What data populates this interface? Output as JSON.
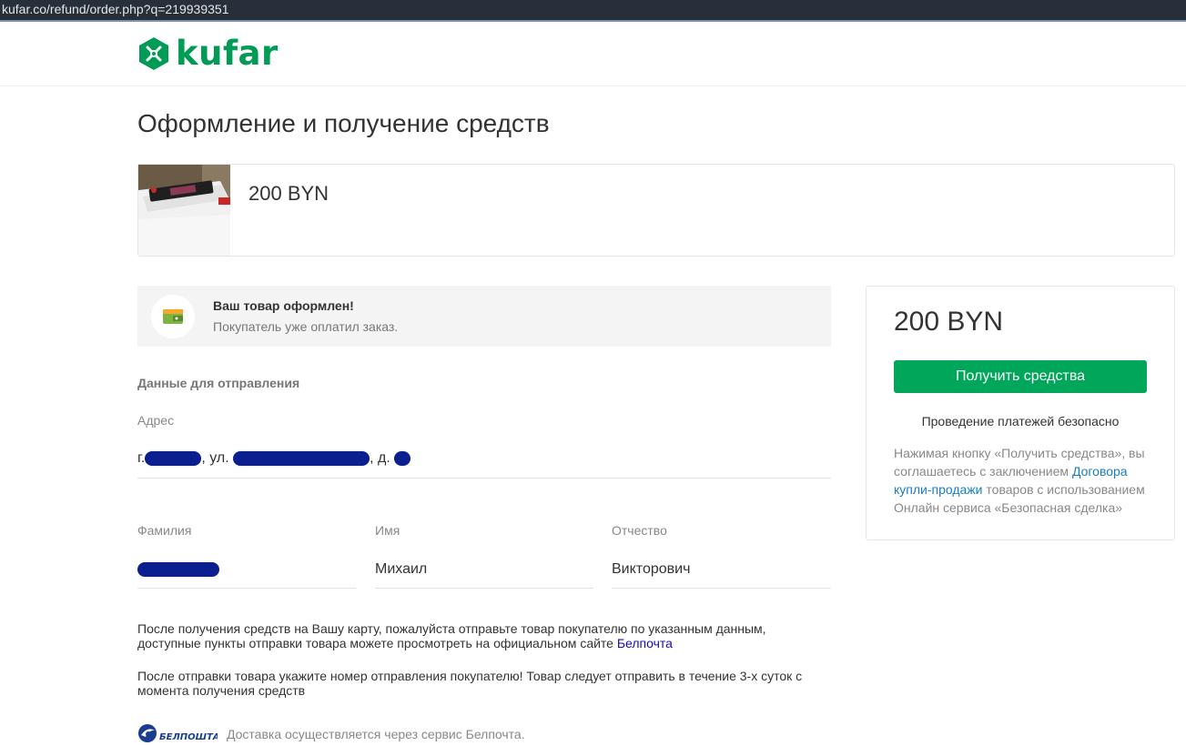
{
  "browser": {
    "url": "kufar.co/refund/order.php?q=219939351"
  },
  "brand": {
    "name": "kufar",
    "color": "#009c56"
  },
  "page": {
    "title": "Оформление и получение средств"
  },
  "product": {
    "price": "200 BYN"
  },
  "notice": {
    "title": "Ваш товар оформлен!",
    "subtitle": "Покупатель уже оплатил заказ."
  },
  "shipping": {
    "section_title": "Данные для отправления",
    "address_label": "Адрес",
    "address_city_prefix": "г.",
    "address_street_prefix": ", ул.",
    "address_house_prefix": ", д.",
    "lastname_label": "Фамилия",
    "firstname_label": "Имя",
    "firstname_value": "Михаил",
    "patronymic_label": "Отчество",
    "patronymic_value": "Викторович"
  },
  "info": {
    "para1": "После получения средств на Вашу карту, пожалуйста отправьте товар покупателю по указанным данным, доступные пункты отправки товара можете просмотреть на официальном сайте",
    "para1_link": "Белпочта",
    "para2": "После отправки товара укажите номер отправления покупателю! Товар следует отправить в течение 3-х суток с момента получения средств"
  },
  "sidebar": {
    "price": "200 BYN",
    "button_label": "Получить средства",
    "secure_text": "Проведение платежей безопасно",
    "agree_text_1": "Нажимая кнопку «Получить средства», вы соглашаетесь с заключением",
    "agree_link": "Договора купли-продажи",
    "agree_text_2": "товаров с использованием Онлайн сервиса «Безопасная сделка»"
  },
  "footer": {
    "logo_text": "БЕЛПОШТА",
    "text": "Доставка осуществляется через сервис Белпочта."
  },
  "colors": {
    "primary_button": "#00a65a",
    "link": "#1a7cc4",
    "redaction": "#0b1f8f"
  }
}
